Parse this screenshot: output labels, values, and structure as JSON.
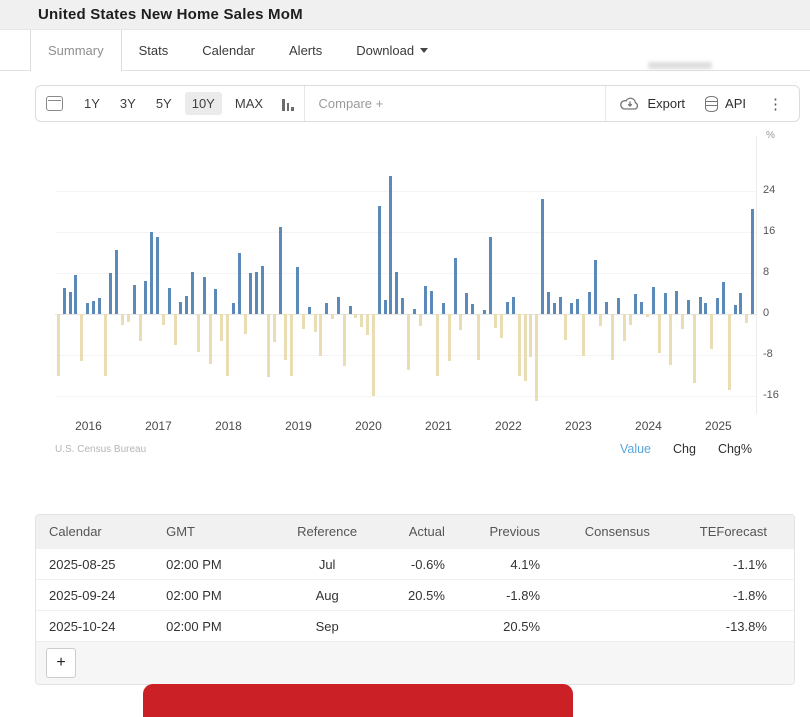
{
  "header": {
    "title": "United States New Home Sales MoM"
  },
  "tabs": [
    {
      "label": "Summary",
      "active": true,
      "caret": false
    },
    {
      "label": "Stats",
      "active": false,
      "caret": false
    },
    {
      "label": "Calendar",
      "active": false,
      "caret": false
    },
    {
      "label": "Alerts",
      "active": false,
      "caret": false
    },
    {
      "label": "Download",
      "active": false,
      "caret": true
    }
  ],
  "toolbar": {
    "ranges": [
      "1Y",
      "3Y",
      "5Y",
      "10Y",
      "MAX"
    ],
    "active_range": "10Y",
    "compare_placeholder": "Compare +",
    "export_label": "Export",
    "api_label": "API",
    "icons": [
      "calendar-icon",
      "column-chart-icon",
      "cloud-download-icon",
      "database-icon",
      "kebab-menu-icon"
    ]
  },
  "chart_data": {
    "type": "bar",
    "title": "United States New Home Sales MoM",
    "unit": "%",
    "start_month": "2015-09",
    "frequency": "monthly",
    "values": [
      -12.0,
      5.0,
      4.2,
      7.6,
      -9.2,
      2.1,
      2.6,
      3.1,
      -12.0,
      8.0,
      12.5,
      -2.2,
      -1.6,
      5.6,
      -5.2,
      6.4,
      16.0,
      15.0,
      -2.1,
      5.1,
      -6.0,
      2.4,
      3.6,
      8.1,
      -7.4,
      7.2,
      -9.8,
      4.9,
      -5.2,
      -12.0,
      2.2,
      12.0,
      -3.9,
      8.0,
      8.2,
      9.4,
      -12.2,
      -5.4,
      17.0,
      -8.9,
      -12.0,
      9.1,
      -2.9,
      1.4,
      -3.6,
      -8.2,
      2.1,
      -0.9,
      3.4,
      -10.2,
      1.5,
      -0.8,
      -2.6,
      -4.1,
      -16.0,
      21.0,
      2.8,
      27.0,
      8.1,
      3.1,
      -11.0,
      0.9,
      -2.4,
      5.5,
      4.4,
      -12.1,
      2.1,
      -9.1,
      11.0,
      -3.1,
      4.1,
      1.9,
      -8.9,
      0.7,
      15.0,
      -2.8,
      -4.6,
      2.3,
      3.4,
      -12.1,
      -13.0,
      -8.4,
      -17.0,
      22.5,
      4.2,
      2.1,
      3.3,
      -5.1,
      2.2,
      2.9,
      -8.1,
      4.3,
      10.5,
      -2.4,
      2.3,
      -8.9,
      3.1,
      -5.3,
      -2.2,
      3.9,
      2.4,
      -0.5,
      5.3,
      -7.7,
      4.1,
      -9.9,
      4.5,
      -2.9,
      2.8,
      -13.5,
      3.4,
      2.1,
      -6.9,
      3.2,
      6.2,
      -14.9,
      1.8,
      4.1,
      -1.8,
      20.5
    ],
    "year_labels": [
      "2016",
      "2017",
      "2018",
      "2019",
      "2020",
      "2021",
      "2022",
      "2023",
      "2024",
      "2025"
    ],
    "yticks": [
      24,
      16,
      8,
      0,
      -8,
      -16
    ],
    "ylim": [
      -19,
      29
    ],
    "grid": true,
    "axis_unit_label": "%",
    "positive_color": "#5b8ab8",
    "negative_color": "#eadcb3",
    "source": "U.S. Census Bureau",
    "legend_modes": [
      "Value",
      "Chg",
      "Chg%"
    ],
    "active_mode": "Value",
    "active_mode_color": "#58a6dd"
  },
  "table": {
    "headers": [
      "Calendar",
      "GMT",
      "Reference",
      "Actual",
      "Previous",
      "Consensus",
      "TEForecast"
    ],
    "rows": [
      [
        "2025-08-25",
        "02:00 PM",
        "Jul",
        "-0.6%",
        "4.1%",
        "",
        "-1.1%"
      ],
      [
        "2025-09-24",
        "02:00 PM",
        "Aug",
        "20.5%",
        "-1.8%",
        "",
        "-1.8%"
      ],
      [
        "2025-10-24",
        "02:00 PM",
        "Sep",
        "",
        "20.5%",
        "",
        "-13.8%"
      ]
    ],
    "add_button_label": "+"
  },
  "banner": {
    "color": "#cb2026"
  }
}
